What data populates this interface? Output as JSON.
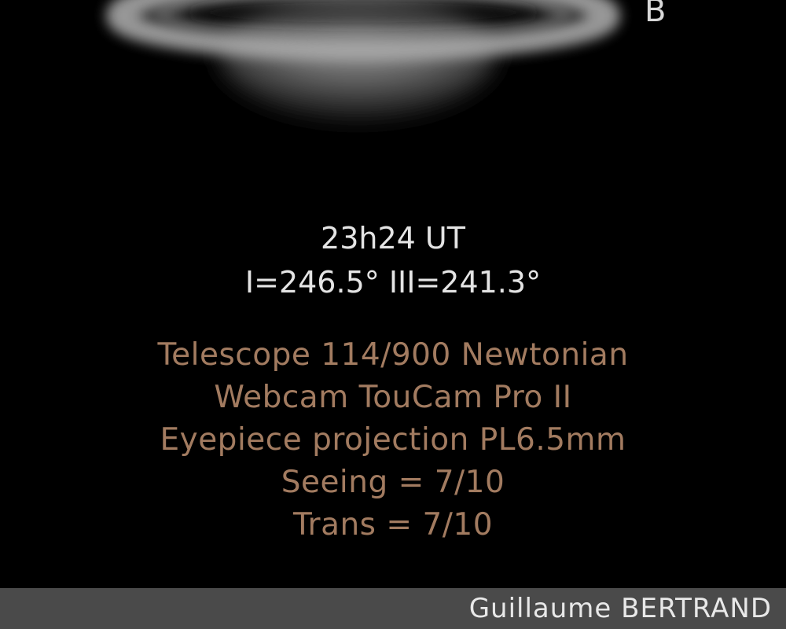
{
  "image": {
    "subject": "Saturn",
    "corner_mark": "B",
    "time": "23h24 UT",
    "longitudes": "I=246.5° III=241.3°",
    "equipment": [
      "Telescope 114/900 Newtonian",
      "Webcam TouCam Pro II",
      "Eyepiece projection PL6.5mm",
      "Seeing = 7/10",
      "Trans = 7/10"
    ],
    "credit": "Guillaume BERTRAND"
  },
  "colors": {
    "background": "#000000",
    "caption_white": "#e4e4e4",
    "caption_brown": "#a27b60",
    "credit_bar": "#4a4a4a",
    "credit_text": "#e8e8e8"
  }
}
